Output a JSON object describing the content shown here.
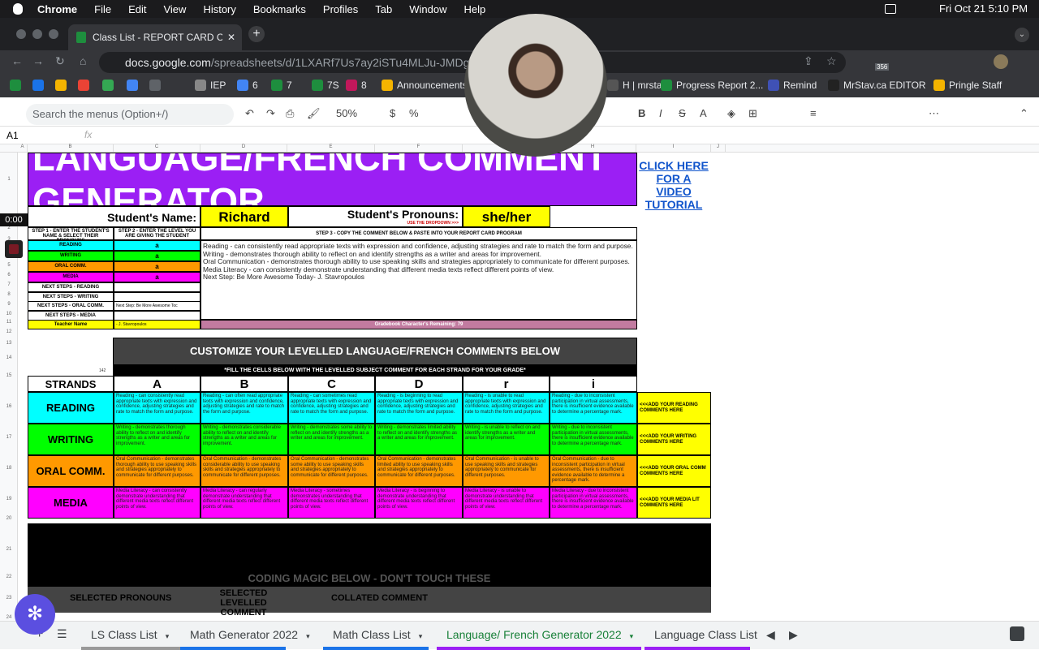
{
  "mac": {
    "apple": "",
    "app": "Chrome",
    "menus": [
      "File",
      "Edit",
      "View",
      "History",
      "Bookmarks",
      "Profiles",
      "Tab",
      "Window",
      "Help"
    ],
    "datetime": "Fri Oct 21  5:10 PM",
    "badge": "356"
  },
  "browser": {
    "tab_title": "Class List - REPORT CARD CO",
    "url_host": "docs.google.com",
    "url_path": "/spreadsheets/d/1LXARf7Us7ay2iSTu4MLJu-JMDg6X7"
  },
  "bookmarks": [
    {
      "label": "",
      "color": "#1e8e3e"
    },
    {
      "label": "",
      "color": "#1a73e8"
    },
    {
      "label": "",
      "color": "#f4b400"
    },
    {
      "label": "",
      "color": "#ea4335"
    },
    {
      "label": "",
      "color": "#34a853"
    },
    {
      "label": "",
      "color": "#4285f4"
    },
    {
      "label": "",
      "color": "#5f6368"
    },
    {
      "label": "IEP",
      "color": "#888"
    },
    {
      "label": "6",
      "color": "#4285f4"
    },
    {
      "label": "7",
      "color": "#1e8e3e"
    },
    {
      "label": "7S",
      "color": "#1e8e3e"
    },
    {
      "label": "8",
      "color": "#c2185b"
    },
    {
      "label": "Announcements",
      "color": "#f4b400"
    },
    {
      "label": "H | mrstav",
      "color": "#555"
    },
    {
      "label": "Progress Report 2...",
      "color": "#1e8e3e"
    },
    {
      "label": "Remind",
      "color": "#3f51b5"
    },
    {
      "label": "MrStav.ca EDITOR",
      "color": "#222"
    },
    {
      "label": "Pringle Staff",
      "color": "#f4b400"
    }
  ],
  "sheet": {
    "search": "Search the menus (Option+/)",
    "zoom": "50%",
    "cell_ref": "A1",
    "fx": "fx",
    "timer": "0:00"
  },
  "content": {
    "title": "LANGUAGE/FRENCH COMMENT GENERATOR",
    "cta": "CLICK HERE FOR A VIDEO TUTORIAL",
    "name_label": "Student's Name:",
    "name_value": "Richard",
    "pron_label": "Student's Pronouns:",
    "pron_hint": "USE THE DROPDOWN >>>",
    "pron_value": "she/her",
    "step1": "STEP 1 - ENTER THE STUDENT'S NAME & SELECT THEIR PRONOUNS",
    "step2": "STEP 2 - ENTER THE LEVEL YOU ARE GIVING THE STUDENT",
    "step3": "STEP 3 - COPY THE COMMENT BELOW & PASTE INTO YOUR REPORT CARD PROGRAM",
    "levels": [
      {
        "label": "READING",
        "value": "a"
      },
      {
        "label": "WRITING",
        "value": "a"
      },
      {
        "label": "ORAL COMM.",
        "value": "a"
      },
      {
        "label": "MEDIA",
        "value": "a"
      }
    ],
    "next": [
      {
        "label": "NEXT STEPS - READING",
        "value": ""
      },
      {
        "label": "NEXT STEPS - WRITING",
        "value": ""
      },
      {
        "label": "NEXT STEPS - ORAL COMM.",
        "value": "Next Step: Be More Awesome Toc"
      },
      {
        "label": "NEXT STEPS - MEDIA",
        "value": ""
      }
    ],
    "teacher_label": "Teacher Name",
    "teacher_value": "- J. Stavropoulos",
    "comment": [
      "Reading - can consistently read appropriate texts with expression and confidence, adjusting strategies and rate to match the form and purpose.",
      "Writing - demonstrates thorough ability to reflect on and identify strengths as a writer and areas for improvement.",
      "Oral Communication - demonstrates thorough ability to use speaking skills and strategies appropriately to communicate for different purposes.",
      "Media Literacy - can consistently demonstrate understanding that different media texts reflect different points of view.",
      "Next Step: Be More Awesome Today- J. Stavropoulos"
    ],
    "chars": "Gradebook Character's Remaining: 79",
    "customize": "CUSTOMIZE YOUR LEVELLED LANGUAGE/FRENCH COMMENTS BELOW",
    "fill": "*FILL THE CELLS BELOW WITH THE LEVELLED SUBJECT COMMENT FOR EACH STRAND FOR YOUR GRADE*",
    "count": "142",
    "strands_label": "STRANDS",
    "level_headers": [
      "A",
      "B",
      "C",
      "D",
      "r",
      "i"
    ],
    "rows": [
      {
        "name": "READING",
        "color": "#00ffff",
        "add": "<<<ADD YOUR READING COMMENTS HERE",
        "cells": [
          "Reading - can consistently read appropriate texts with expression and confidence, adjusting strategies and rate to match the form and purpose.",
          "Reading - can often read appropriate texts with expression and confidence, adjusting strategies and rate to match the form and purpose.",
          "Reading - can sometimes read appropriate texts with expression and confidence, adjusting strategies and rate to match the form and purpose.",
          "Reading - is beginning to read appropriate texts with expression and confidence, adjusting strategies and rate to match the form and purpose.",
          "Reading - is unable to read appropriate texts with expression and confidence, adjusting strategies and rate to match the form and purpose.",
          "Reading - due to inconsistent participation in virtual assessments, there is insufficient evidence available to determine a percentage mark."
        ]
      },
      {
        "name": "WRITING",
        "color": "#00ff00",
        "add": "<<<ADD YOUR WRITING COMMENTS HERE",
        "cells": [
          "Writing - demonstrates thorough ability to reflect on and identify strengths as a writer and areas for improvement.",
          "Writing - demonstrates considerable ability to reflect on and identify strengths as a writer and areas for improvement.",
          "Writing - demonstrates some ability to reflect on and identify strengths as a writer and areas for improvement.",
          "Writing - demonstrates limited ability to reflect on and identify strengths as a writer and areas for improvement.",
          "Writing - is unable to reflect on and identify strengths as a writer and areas for improvement.",
          "Writing - due to inconsistent participation in virtual assessments, there is insufficient evidence available to determine a percentage mark."
        ]
      },
      {
        "name": "ORAL COMM.",
        "color": "#ff9900",
        "add": "<<<ADD YOUR ORAL COMM COMMENTS HERE",
        "cells": [
          "Oral Communication - demonstrates thorough ability to use speaking skills and strategies appropriately to communicate for different purposes.",
          "Oral Communication - demonstrates considerable ability to use speaking skills and strategies appropriately to communicate for different purposes.",
          "Oral Communication - demonstrates some ability to use speaking skills and strategies appropriately to communicate for different purposes.",
          "Oral Communication - demonstrates limited ability to use speaking skills and strategies appropriately to communicate for different purposes.",
          "Oral Communication - is unable to use speaking skills and strategies appropriately to communicate for different purposes.",
          "Oral Communication - due to inconsistent participation in virtual assessments, there is insufficient evidence available to determine a percentage mark."
        ]
      },
      {
        "name": "MEDIA",
        "color": "#ff00ff",
        "add": "<<<ADD YOUR MEDIA LIT COMMENTS HERE",
        "cells": [
          "Media Literacy - can consistently demonstrate understanding that different media texts reflect different points of view.",
          "Media Literacy - can regularly demonstrate understanding that different media texts reflect different points of view.",
          "Media Literacy - sometimes demonstrates understanding that different media texts reflect different points of view.",
          "Media Literacy - is beginning to demonstrate understanding that different media texts reflect different points of view.",
          "Media Literacy - is unable to demonstrate understanding that different media texts reflect different points of view.",
          "Media Literacy - due to inconsistent participation in virtual assessments, there is insufficient evidence available to determine a percentage mark."
        ]
      }
    ],
    "coding": "CODING MAGIC BELOW - DON'T TOUCH THESE",
    "selected_pronouns": "SELECTED PRONOUNS",
    "selected_comment": "SELECTED LEVELLED COMMENT",
    "collated": "COLLATED COMMENT"
  },
  "tabs": [
    {
      "label": "LS Class List",
      "color": "#999"
    },
    {
      "label": "Math Generator 2022",
      "color": "#1a73e8"
    },
    {
      "label": "Math Class List",
      "color": "#1a73e8"
    },
    {
      "label": "Language/ French Generator 2022",
      "color": "#9b1ff4"
    },
    {
      "label": "Language Class List",
      "color": "#9b1ff4"
    }
  ],
  "col_letters": [
    "A",
    "B",
    "C",
    "D",
    "E",
    "F",
    "G",
    "H",
    "I",
    "J"
  ],
  "row_numbers": [
    "1",
    "2",
    "3",
    "4",
    "5",
    "6",
    "7",
    "8",
    "9",
    "10",
    "11",
    "12",
    "13",
    "14",
    "15",
    "16",
    "17",
    "18",
    "19",
    "20",
    "21",
    "22",
    "23",
    "24"
  ]
}
